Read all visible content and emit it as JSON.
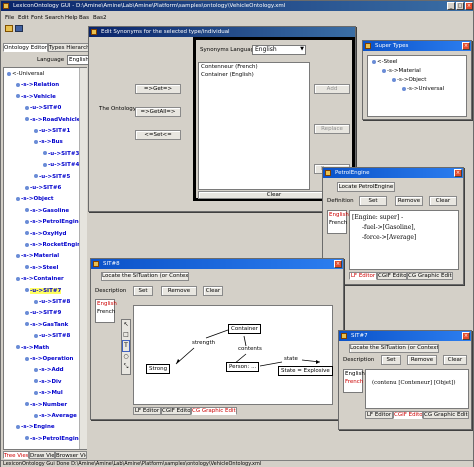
{
  "main": {
    "title": "LexiconOntology GUI - D:\\Amine\\Amine\\Lab\\Amine\\Platform\\samples\\ontology\\VehicleOntology.xml",
    "menu": [
      "File",
      "Edit",
      "Font",
      "Search",
      "Help",
      "Bas",
      "Bas2"
    ],
    "tabs": [
      "Ontology Editor",
      "Types Hierarchy Operations"
    ],
    "language_value": "English",
    "tree": [
      {
        "text": "<-Universal",
        "depth": 0,
        "kind": "root"
      },
      {
        "text": "-s->Relation",
        "depth": 1,
        "kind": "c"
      },
      {
        "text": "-s->Vehicle",
        "depth": 1,
        "kind": "c"
      },
      {
        "text": "-u->SIT#0",
        "depth": 2,
        "kind": "c"
      },
      {
        "text": "-s->RoadVehicle",
        "depth": 2,
        "kind": "c"
      },
      {
        "text": "-u->SIT#1",
        "depth": 3,
        "kind": "c"
      },
      {
        "text": "-s->Bus",
        "depth": 3,
        "kind": "c"
      },
      {
        "text": "-u->SIT#3",
        "depth": 4,
        "kind": "c"
      },
      {
        "text": "-u->SIT#4",
        "depth": 4,
        "kind": "c"
      },
      {
        "text": "-u->SIT#5",
        "depth": 3,
        "kind": "c"
      },
      {
        "text": "-u->SIT#6",
        "depth": 2,
        "kind": "c"
      },
      {
        "text": "-s->Object",
        "depth": 1,
        "kind": "c"
      },
      {
        "text": "-s->Gasoline",
        "depth": 2,
        "kind": "c"
      },
      {
        "text": "-s->PetrolEngine",
        "depth": 2,
        "kind": "c"
      },
      {
        "text": "-s->OxyHyd",
        "depth": 2,
        "kind": "c"
      },
      {
        "text": "-s->RocketEngine",
        "depth": 2,
        "kind": "c"
      },
      {
        "text": "-s->Material",
        "depth": 1,
        "kind": "c"
      },
      {
        "text": "-s->Steel",
        "depth": 2,
        "kind": "c"
      },
      {
        "text": "-s->Container",
        "depth": 1,
        "kind": "c"
      },
      {
        "text": "-u->SIT#7",
        "depth": 2,
        "kind": "c",
        "highlight": true
      },
      {
        "text": "-u->SIT#8",
        "depth": 3,
        "kind": "c"
      },
      {
        "text": "-u->SIT#9",
        "depth": 2,
        "kind": "c"
      },
      {
        "text": "-s->GasTank",
        "depth": 2,
        "kind": "c"
      },
      {
        "text": "-u->SIT#8",
        "depth": 3,
        "kind": "c"
      },
      {
        "text": "-s->Math",
        "depth": 1,
        "kind": "c"
      },
      {
        "text": "-s->Operation",
        "depth": 2,
        "kind": "c"
      },
      {
        "text": "-s->Add",
        "depth": 3,
        "kind": "c"
      },
      {
        "text": "-s->Div",
        "depth": 3,
        "kind": "c"
      },
      {
        "text": "-s->Mul",
        "depth": 3,
        "kind": "c"
      },
      {
        "text": "-s->Number",
        "depth": 2,
        "kind": "c"
      },
      {
        "text": "-s->Average",
        "depth": 3,
        "kind": "c"
      },
      {
        "text": "-s->Engine",
        "depth": 1,
        "kind": "c"
      },
      {
        "text": "-s->PetrolEngine",
        "depth": 2,
        "kind": "c"
      }
    ],
    "bottom_tabs": [
      "Tree View",
      "Draw View",
      "Browser View"
    ],
    "status": "LexiconOntology Gui Done  D:\\Amine\\Amine\\Lab\\Amine\\Platform\\samples\\ontology\\VehicleOntology.xml"
  },
  "synonyms_dialog": {
    "title": "Edit Synonyms for the selected type/individual",
    "ontology_label": "The Ontology",
    "btn_get": "=>Get=>",
    "btn_getall": "=>GetAll=>",
    "btn_set": "<=Set<=",
    "synonyms_language_label": "Synonyms Language",
    "synonyms_language_value": "English",
    "synonyms": [
      "Contenneur (French)",
      "Container (English)"
    ],
    "side_buttons": [
      "Add",
      "Replace",
      "Remove"
    ],
    "clear": "Clear"
  },
  "supertypes": {
    "title": "Super Types",
    "tree": [
      "<-Steel",
      "-s->Material",
      "-s->Object",
      "-s->Universal"
    ]
  },
  "petrol": {
    "title": "PetrolEngine",
    "locate_btn": "Locate PetrolEngine",
    "definition_label": "Definition",
    "buttons": [
      "Set",
      "Remove",
      "Clear"
    ],
    "languages": [
      "English",
      "French"
    ],
    "content": [
      "[Engine: super] -",
      "-fuel->[Gasoline],",
      "-force->[Average]"
    ],
    "tabs": [
      "LF Editor",
      "CGIF Editor",
      "CG Graphic Editor"
    ]
  },
  "sit8": {
    "title": "SIT#8",
    "locate_btn": "Locate the SITuation (or Context)",
    "description_label": "Description",
    "buttons": [
      "Set",
      "Remove",
      "Clear"
    ],
    "languages": [
      "English",
      "French"
    ],
    "nodes": {
      "container": "Container",
      "strong": "Strong",
      "person": "Person: ...",
      "state": "State = Explosive"
    },
    "relations": {
      "strength": "strength",
      "contents": "contents",
      "state": "state"
    },
    "tabs": [
      "LF Editor",
      "CGIF Editor",
      "CG Graphic Editor"
    ]
  },
  "sit7": {
    "title": "SIT#7",
    "locate_btn": "Locate the SITuation (or Context)",
    "description_label": "Description",
    "buttons": [
      "Set",
      "Remove",
      "Clear"
    ],
    "languages": [
      "English",
      "French"
    ],
    "content": "(contenu [Conteneur] [Objet])",
    "tabs": [
      "LF Editor",
      "CGIF Editor",
      "CG Graphic Editor"
    ]
  }
}
